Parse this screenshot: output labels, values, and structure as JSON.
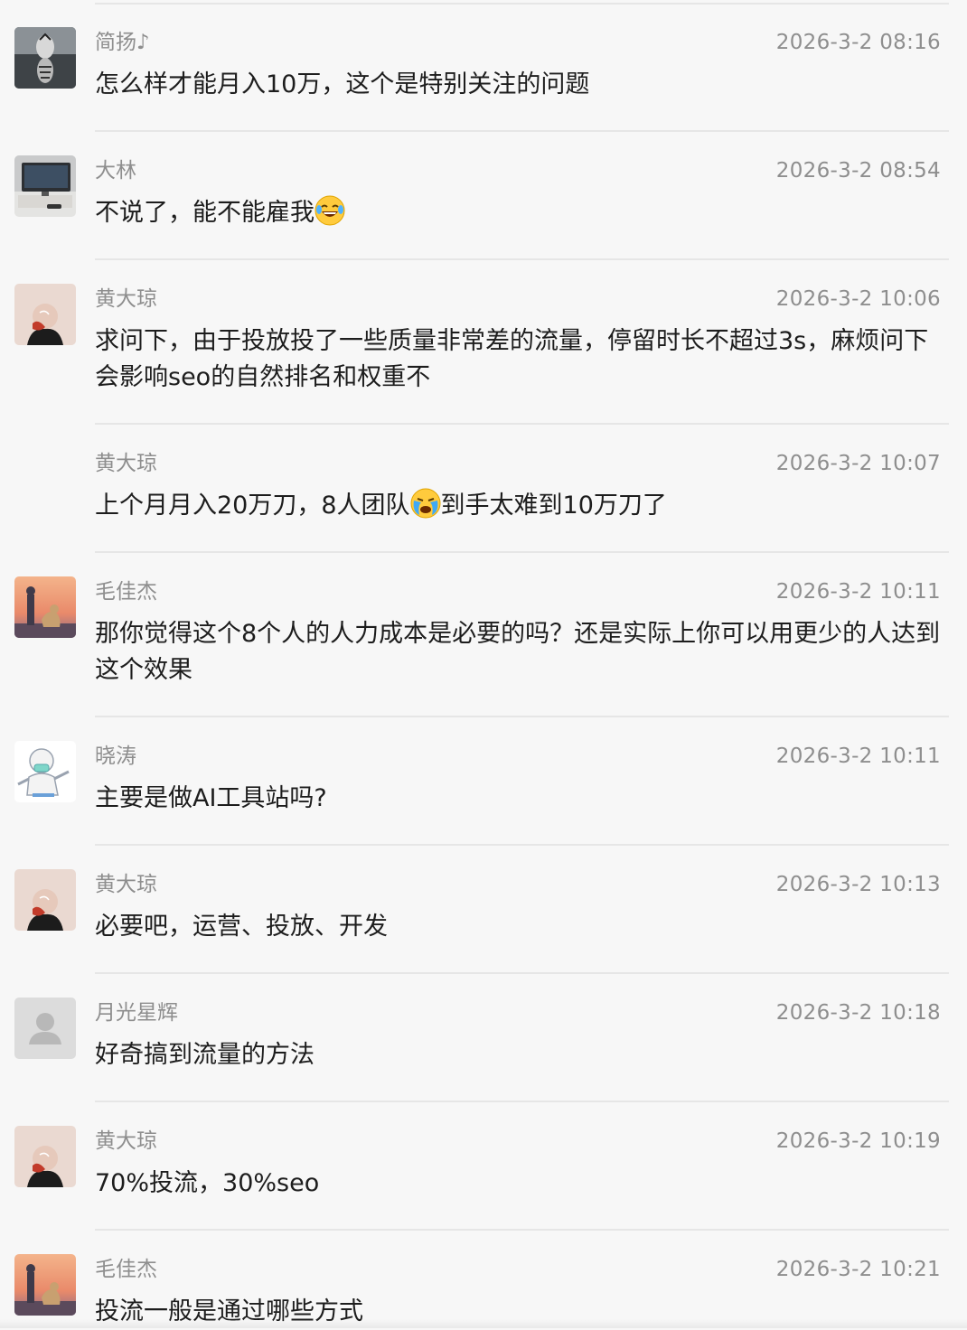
{
  "messages": [
    {
      "name": "简扬♪",
      "time": "2026-3-2 08:16",
      "text": "怎么样才能月入10万，这个是特别关注的问题",
      "text_after": "",
      "emoji": "",
      "avatar": "tiger-avatar"
    },
    {
      "name": "大林",
      "time": "2026-3-2 08:54",
      "text": "不说了，能不能雇我",
      "text_after": "",
      "emoji": "laughing-emoji",
      "avatar": "desk-avatar"
    },
    {
      "name": "黄大琼",
      "time": "2026-3-2 10:06",
      "text": "求问下，由于投放投了一些质量非常差的流量，停留时长不超过3s，麻烦问下会影响seo的自然排名和权重不",
      "text_after": "",
      "emoji": "",
      "avatar": "person-avatar"
    },
    {
      "name": "黄大琼",
      "time": "2026-3-2 10:07",
      "text": "上个月月入20万刀，8人团队",
      "text_after": "到手太难到10万刀了",
      "emoji": "crying-emoji",
      "avatar": ""
    },
    {
      "name": "毛佳杰",
      "time": "2026-3-2 10:11",
      "text": "那你觉得这个8个人的人力成本是必要的吗？还是实际上你可以用更少的人达到这个效果",
      "text_after": "",
      "emoji": "",
      "avatar": "sunset-avatar"
    },
    {
      "name": "晓涛",
      "time": "2026-3-2 10:11",
      "text": "主要是做AI工具站吗?",
      "text_after": "",
      "emoji": "",
      "avatar": "cartoon-avatar"
    },
    {
      "name": "黄大琼",
      "time": "2026-3-2 10:13",
      "text": "必要吧，运营、投放、开发",
      "text_after": "",
      "emoji": "",
      "avatar": "person-avatar"
    },
    {
      "name": "月光星辉",
      "time": "2026-3-2 10:18",
      "text": "好奇搞到流量的方法",
      "text_after": "",
      "emoji": "",
      "avatar": "default-avatar"
    },
    {
      "name": "黄大琼",
      "time": "2026-3-2 10:19",
      "text": "70%投流，30%seo",
      "text_after": "",
      "emoji": "",
      "avatar": "person-avatar"
    },
    {
      "name": "毛佳杰",
      "time": "2026-3-2 10:21",
      "text": "投流一般是通过哪些方式",
      "text_after": "",
      "emoji": "",
      "avatar": "sunset-avatar"
    }
  ]
}
